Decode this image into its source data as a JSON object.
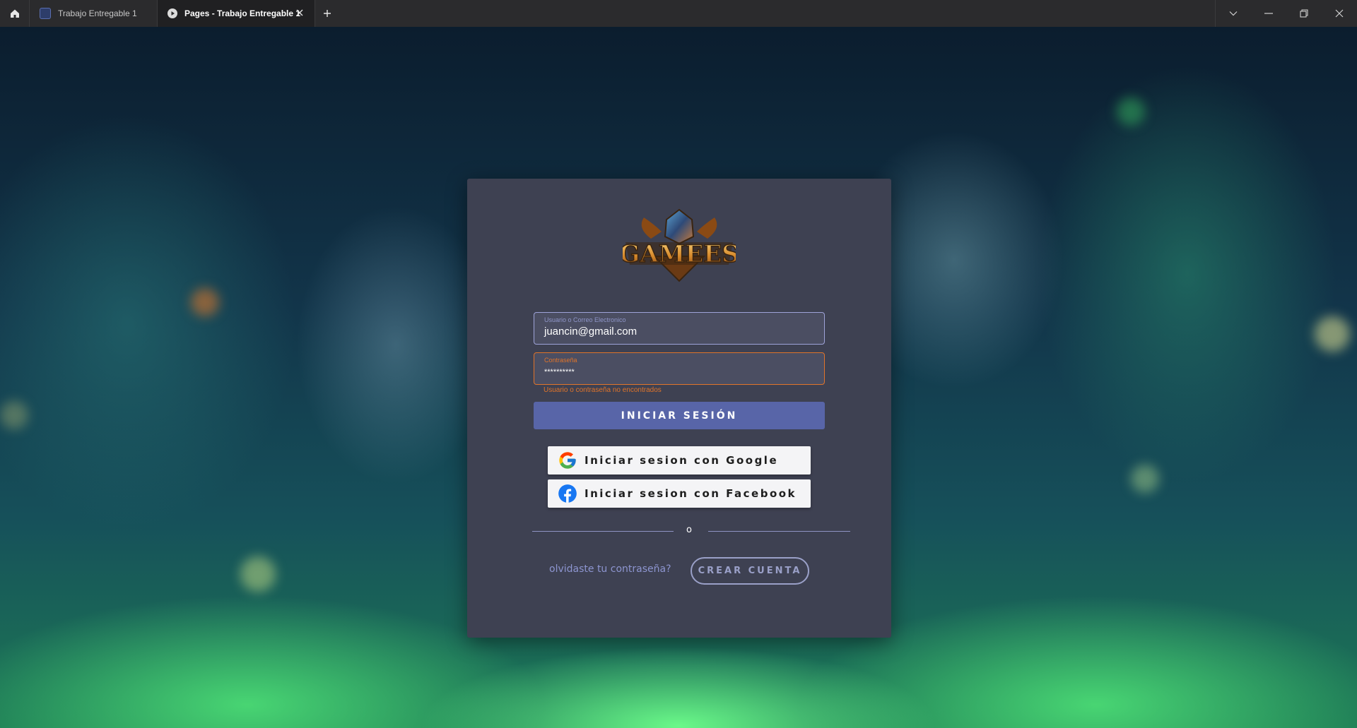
{
  "browser": {
    "tabs": [
      {
        "label": "Trabajo Entregable 1",
        "active": false
      },
      {
        "label": "Pages - Trabajo Entregable 1",
        "active": true
      }
    ],
    "icons": {
      "home": "home-icon",
      "close_tab": "close-icon",
      "new_tab": "plus-icon",
      "dropdown": "chevron-down-icon",
      "minimize": "minimize-icon",
      "restore": "restore-icon",
      "close_window": "close-icon"
    }
  },
  "login": {
    "logo_text": "GAMEES",
    "email": {
      "label": "Usuario o Correo Electronico",
      "value": "juancin@gmail.com"
    },
    "password": {
      "label": "Contraseña",
      "value": "**********"
    },
    "error": "Usuario o contraseña no encontrados",
    "submit_label": "INICIAR SESIÓN",
    "google_label": "Iniciar sesion con Google",
    "facebook_label": "Iniciar sesion con Facebook",
    "divider_text": "o",
    "forgot_label": "olvidaste tu contraseña?",
    "create_account_label": "CREAR CUENTA"
  },
  "colors": {
    "card": "#3e4152",
    "primary_button": "#5865a8",
    "error": "#e0742a",
    "accent_text": "#8d95d0"
  }
}
